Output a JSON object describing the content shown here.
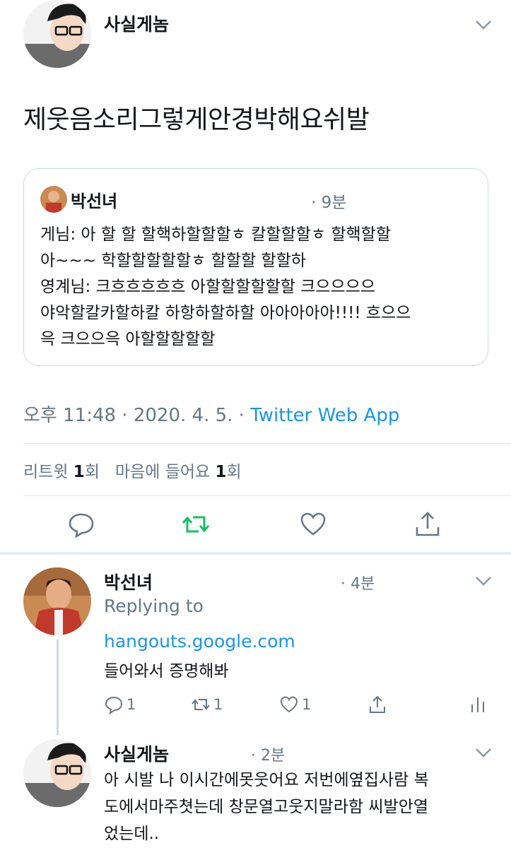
{
  "main_tweet": {
    "author": "사실게놈",
    "text": "제웃음소리그렇게안경박해요쉬발",
    "quote": {
      "author": "박선녀",
      "time": "· 9분",
      "lines": [
        "게님: 아 할 할 할핵하할할할ㅎ 칼할할할ㅎ 할핵할할",
        "아~~~ 학할할할할할ㅎ 할할할 할할하",
        "영계님: 크흐흐흐흐흐 아할할할할할할 크으으으으",
        "야악할칼카할하칼 하항하할하할 아아아아아!!!! 흐으으",
        "윽 크으으윽 아할할할할할"
      ]
    },
    "meta_time": "오후 11:48 · 2020. 4. 5. · ",
    "meta_source": "Twitter Web App",
    "retweets_label": "리트윗",
    "retweets_count": "1",
    "retweets_unit": "회",
    "likes_label": "마음에 들어요",
    "likes_count": "1",
    "likes_unit": "회"
  },
  "replies": [
    {
      "author": "박선녀",
      "time": "· 4분",
      "replying_to": "Replying to",
      "link": "hangouts.google.com",
      "text": "들어와서 증명해봐",
      "reply_count": "1",
      "retweet_count": "1",
      "like_count": "1"
    },
    {
      "author": "사실게놈",
      "time": "· 2분",
      "lines": [
        "아 시발 나 이시간에못웃어요 저번에옆집사람 복",
        "도에서마주쳣는데 창문열고웃지말라함 씨발안열",
        "었는데.."
      ]
    }
  ],
  "colors": {
    "accent_link": "#1b95e0",
    "retweet_green": "#17bf63",
    "secondary_text": "#657786",
    "divider": "#e1e8ed"
  }
}
